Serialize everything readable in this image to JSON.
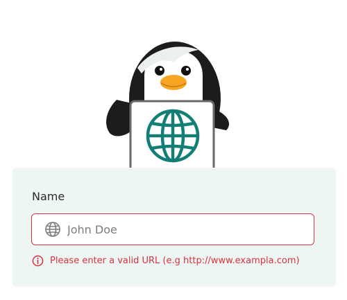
{
  "form": {
    "name_label": "Name",
    "url_input": {
      "placeholder": "John Doe",
      "value": ""
    },
    "error_message": "Please enter a valid URL (e.g http://www.exampla.com)"
  },
  "icons": {
    "input_icon": "globe-icon",
    "sign_icon": "globe-icon",
    "error_icon": "info-circle-icon"
  },
  "colors": {
    "error": "#d8313f",
    "sign_globe": "#127e76",
    "card_background": "#eef6f3",
    "beak": "#f6a623"
  }
}
